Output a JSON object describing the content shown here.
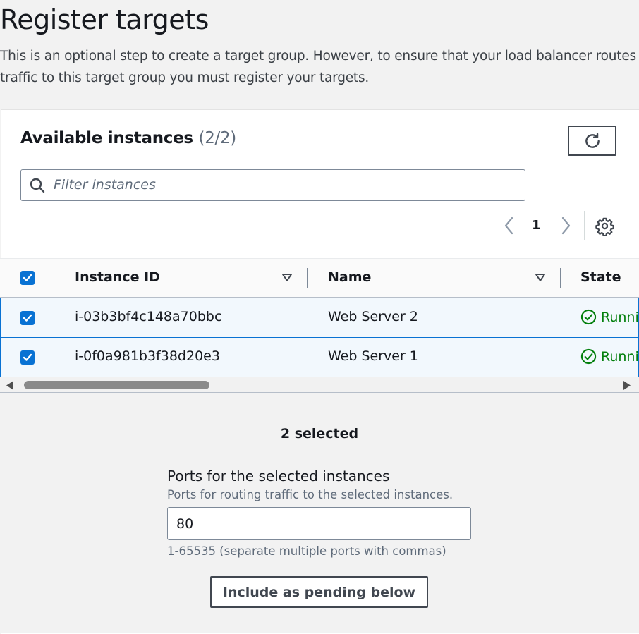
{
  "page": {
    "title": "Register targets",
    "description": "This is an optional step to create a target group. However, to ensure that your load balancer routes traffic to this target group you must register your targets."
  },
  "instances_panel": {
    "title": "Available instances",
    "count": "(2/2)",
    "refresh_icon": "refresh-icon",
    "filter_placeholder": "Filter instances",
    "filter_value": "",
    "pagination": {
      "current_page": "1"
    },
    "columns": [
      {
        "label": "Instance ID",
        "sortable": true
      },
      {
        "label": "Name",
        "sortable": true
      },
      {
        "label": "State",
        "sortable": false
      }
    ],
    "rows": [
      {
        "checked": true,
        "instance_id": "i-03b3bf4c148a70bbc",
        "name": "Web Server 2",
        "state": "Runni"
      },
      {
        "checked": true,
        "instance_id": "i-0f0a981b3f38d20e3",
        "name": "Web Server 1",
        "state": "Runni"
      }
    ],
    "select_all_checked": true
  },
  "selection": {
    "selected_text": "2 selected",
    "ports_label": "Ports for the selected instances",
    "ports_description": "Ports for routing traffic to the selected instances.",
    "ports_value": "80",
    "ports_hint": "1-65535 (separate multiple ports with commas)",
    "include_button": "Include as pending below"
  },
  "colors": {
    "accent": "#0972d3",
    "running": "#037f0c",
    "border": "#7d8998"
  }
}
